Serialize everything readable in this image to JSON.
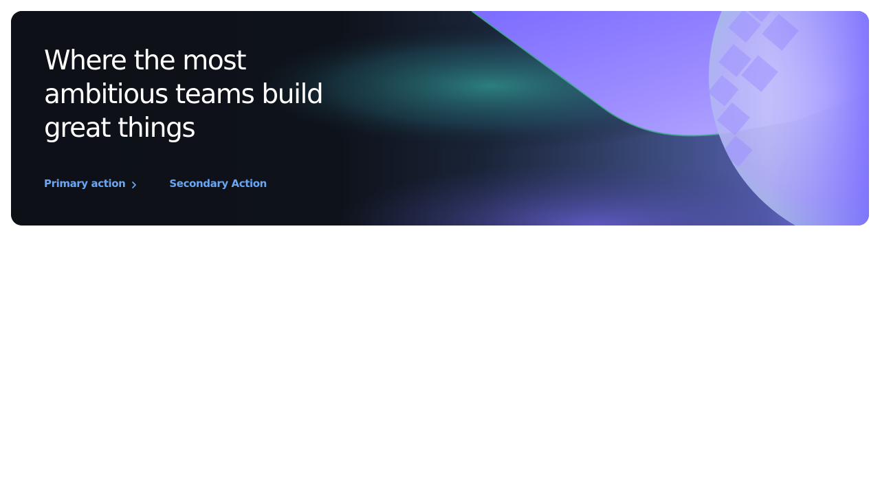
{
  "hero": {
    "title": "Where the most\nambitious teams build\ngreat things",
    "primary_action": {
      "label": "Primary action",
      "icon": "chevron-right-icon"
    },
    "secondary_action": {
      "label": "Secondary Action"
    }
  },
  "colors": {
    "background": "#0d1017",
    "page": "#ffffff",
    "title": "#ffffff",
    "link": "#6aa6f2",
    "accent_purple": "#7f6cff",
    "accent_teal": "#5fe0b0"
  }
}
